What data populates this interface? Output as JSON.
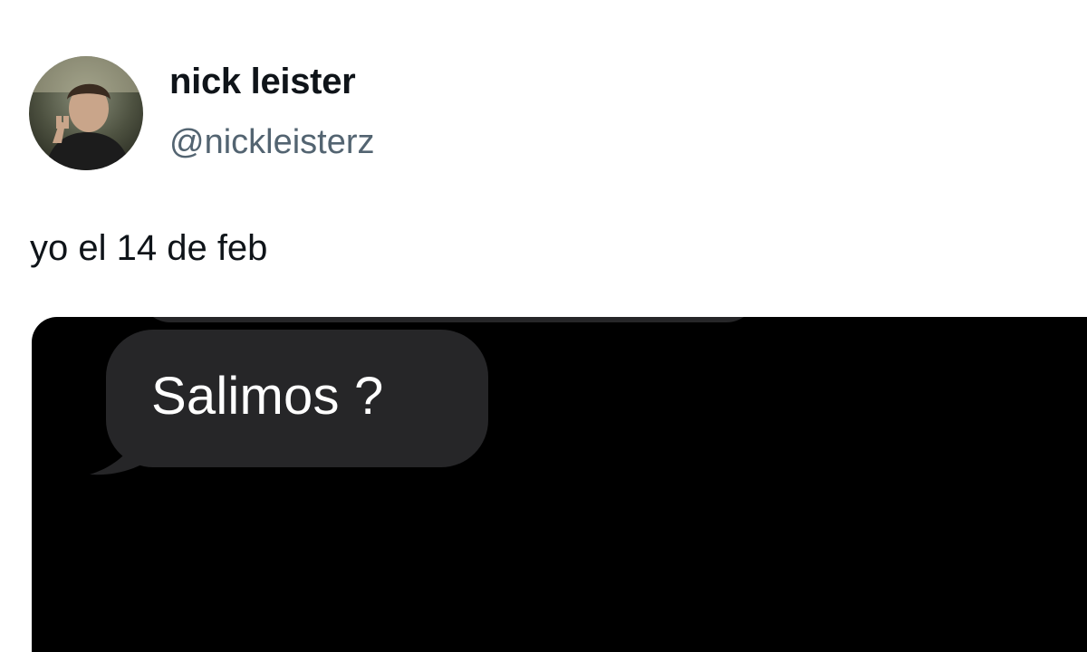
{
  "author": {
    "display_name": "nick leister",
    "handle": "@nickleisterz",
    "avatar_icon": "profile-photo"
  },
  "tweet": {
    "text": "yo el 14 de feb"
  },
  "media": {
    "background": "#000000",
    "bubble_color": "#262628",
    "message_text": "Salimos ?"
  },
  "colors": {
    "name": "#0f1419",
    "handle": "#536471"
  }
}
